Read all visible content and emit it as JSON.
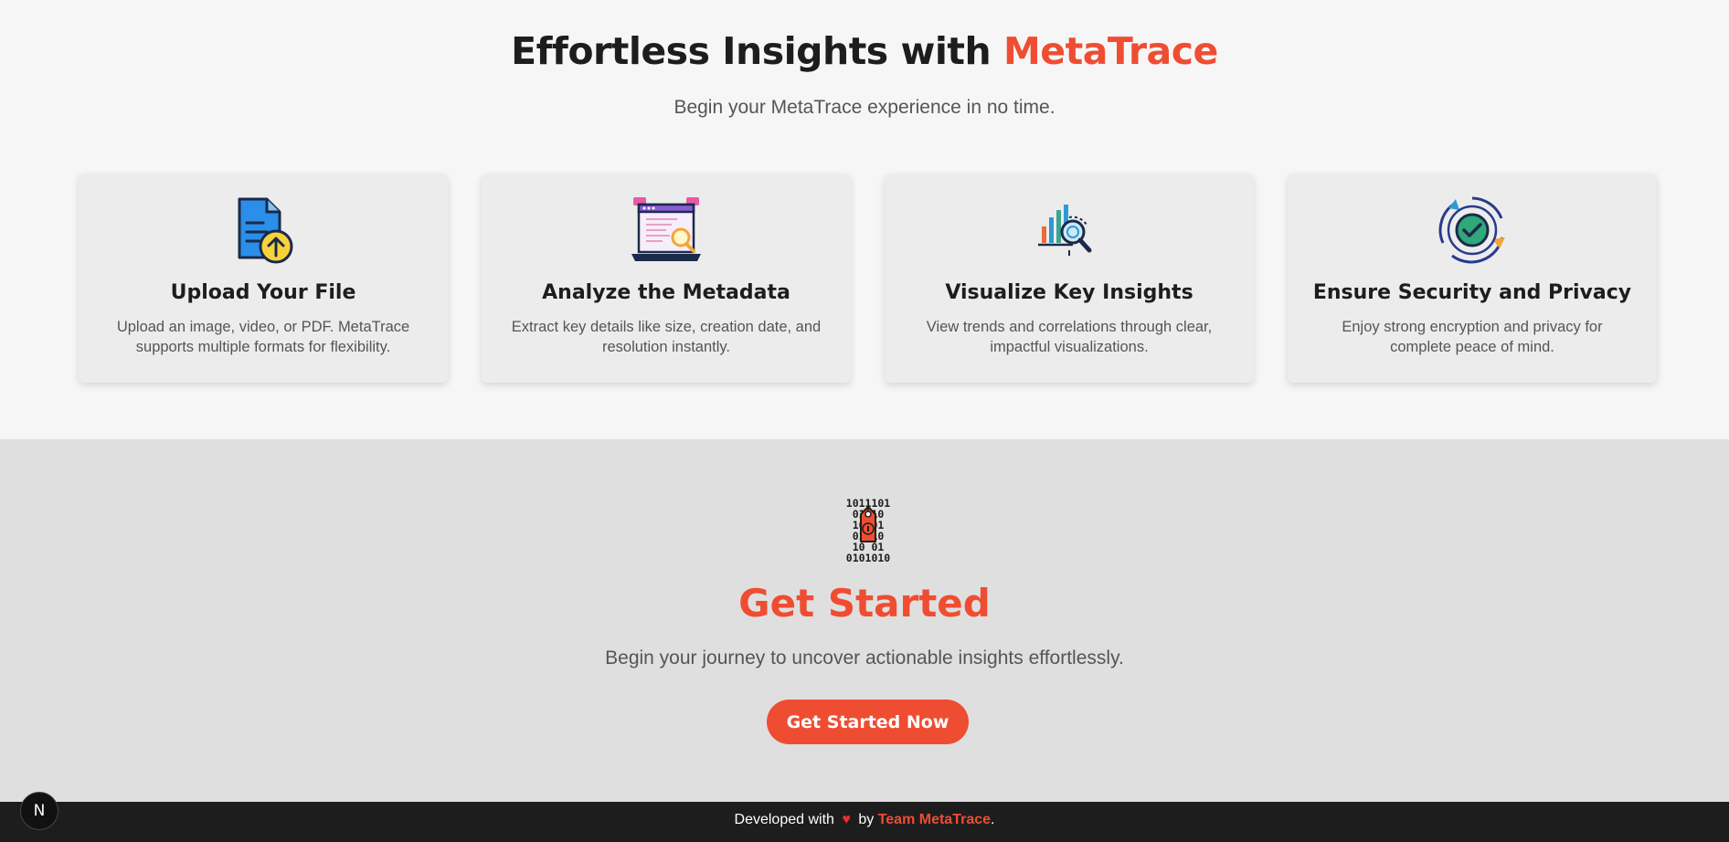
{
  "hero": {
    "title_prefix": "Effortless Insights with ",
    "title_brand": "MetaTrace",
    "subtitle": "Begin your MetaTrace experience in no time."
  },
  "features": [
    {
      "icon": "upload-file-icon",
      "title": "Upload Your File",
      "description": "Upload an image, video, or PDF. MetaTrace supports multiple formats for flexibility."
    },
    {
      "icon": "analyze-laptop-icon",
      "title": "Analyze the Metadata",
      "description": "Extract key details like size, creation date, and resolution instantly."
    },
    {
      "icon": "chart-magnifier-icon",
      "title": "Visualize Key Insights",
      "description": "View trends and correlations through clear, impactful visualizations."
    },
    {
      "icon": "shield-check-icon",
      "title": "Ensure Security and Privacy",
      "description": "Enjoy strong encryption and privacy for complete peace of mind."
    }
  ],
  "cta": {
    "icon": "binary-tag-logo-icon",
    "binary_rows": [
      "1011101",
      "01 10",
      "10 01",
      "01 10",
      "10 01",
      "0101010"
    ],
    "title": "Get Started",
    "subtitle": "Begin your journey to uncover actionable insights effortlessly.",
    "button_label": "Get Started Now"
  },
  "footer": {
    "prefix": "Developed with",
    "heart": "♥",
    "by": "by",
    "team": "Team MetaTrace",
    "suffix": "."
  },
  "dev_badge": {
    "label": "N"
  },
  "colors": {
    "accent": "#ef4d32",
    "footer_bg": "#1d1d1d",
    "hero_bg": "#f6f6f6",
    "cta_bg": "#dfdfdf",
    "card_bg": "#ececec"
  }
}
